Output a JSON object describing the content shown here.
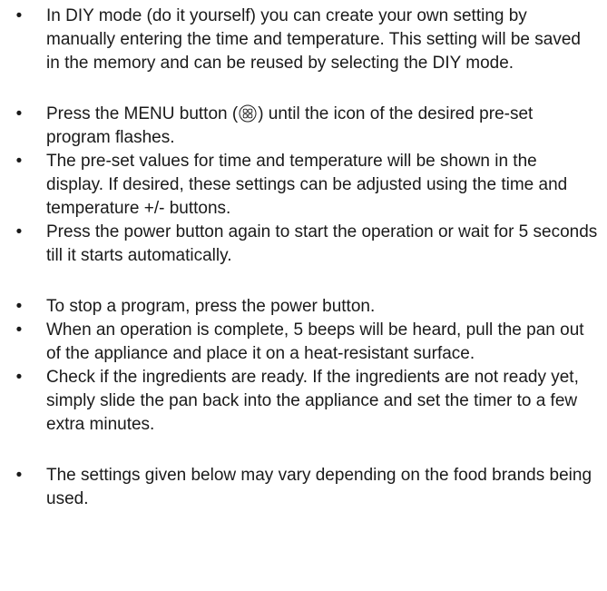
{
  "bullet_glyph": "•",
  "groups": [
    {
      "items": [
        {
          "text": "In DIY mode (do it yourself) you can create your own setting by manually entering the time and temperature. This setting will be saved in the memory and can be reused by selecting the DIY mode."
        }
      ]
    },
    {
      "items": [
        {
          "text_before_icon": "Press the MENU button (",
          "icon": "menu-grid-icon",
          "text_after_icon": ") until the icon of the desired pre-set program flashes."
        },
        {
          "text": "The pre-set values for time and temperature will be shown in the display. If desired, these settings can be adjusted using the time and temperature +/- buttons."
        },
        {
          "text": "Press the power button again to start the operation or wait for 5 seconds till it starts automatically."
        }
      ]
    },
    {
      "items": [
        {
          "text": "To stop a program, press the power button."
        },
        {
          "text": "When an operation is complete, 5 beeps will be heard, pull the pan out of the appliance and place it on a heat-resistant surface."
        },
        {
          "text": "Check if the ingredients are ready. If the ingredients are not ready yet, simply slide the pan back into the appliance and set the timer to a few extra minutes."
        }
      ]
    },
    {
      "items": [
        {
          "text": "The settings given below may vary depending on the food brands being used."
        }
      ]
    }
  ]
}
